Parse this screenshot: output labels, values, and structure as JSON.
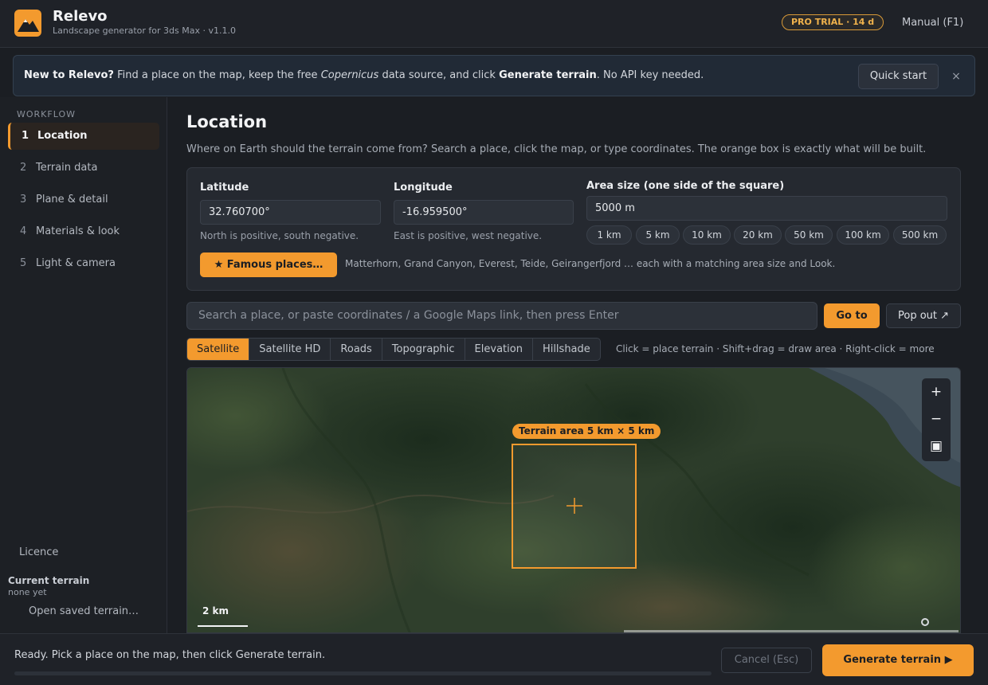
{
  "app": {
    "title": "Relevo",
    "subtitle": "Landscape generator for 3ds Max  ·  v1.1.0",
    "pro_badge": "PRO TRIAL · 14 d",
    "manual_link": "Manual  (F1)"
  },
  "banner": {
    "lead": "New to Relevo?",
    "text_1": " Find a place on the map, keep the free ",
    "source": "Copernicus",
    "text_2": " data source, and click ",
    "action": "Generate terrain",
    "text_3": ". No API key needed.",
    "quick_start": "Quick start",
    "close": "×"
  },
  "sidebar": {
    "section_label": "WORKFLOW",
    "items": [
      {
        "num": "1",
        "label": "Location",
        "active": true
      },
      {
        "num": "2",
        "label": "Terrain data",
        "active": false
      },
      {
        "num": "3",
        "label": "Plane & detail",
        "active": false
      },
      {
        "num": "4",
        "label": "Materials & look",
        "active": false
      },
      {
        "num": "5",
        "label": "Light & camera",
        "active": false
      }
    ],
    "licence": "Licence",
    "current_terrain_label": "Current terrain",
    "current_terrain_value": "none yet",
    "open_saved": "Open saved terrain…"
  },
  "main": {
    "title": "Location",
    "description": "Where on Earth should the terrain come from? Search a place, click the map, or type coordinates. The orange box is exactly what will be built.",
    "latitude": {
      "label": "Latitude",
      "value": "32.760700°",
      "hint": "North is positive, south negative."
    },
    "longitude": {
      "label": "Longitude",
      "value": "-16.959500°",
      "hint": "East is positive, west negative."
    },
    "area": {
      "label": "Area size (one side of the square)",
      "value": "5000 m",
      "presets": [
        "1 km",
        "5 km",
        "10 km",
        "20 km",
        "50 km",
        "100 km",
        "500 km"
      ]
    },
    "famous_button": "★  Famous places…",
    "famous_hint": "Matterhorn, Grand Canyon, Everest, Teide, Geirangerfjord … each with a matching area size and Look.",
    "search_placeholder": "Search a place, or paste coordinates / a Google Maps link, then press Enter",
    "goto_button": "Go to",
    "popout_button": "Pop out ↗",
    "map_tabs": [
      {
        "label": "Satellite",
        "active": true
      },
      {
        "label": "Satellite HD",
        "active": false
      },
      {
        "label": "Roads",
        "active": false
      },
      {
        "label": "Topographic",
        "active": false
      },
      {
        "label": "Elevation",
        "active": false
      },
      {
        "label": "Hillshade",
        "active": false
      }
    ],
    "map_hint": "Click = place terrain · Shift+drag = draw area · Right-click = more"
  },
  "map": {
    "zoom_in": "+",
    "zoom_out": "−",
    "fit": "▣",
    "terrain_label": "Terrain area  5 km × 5 km",
    "scale_label": "2 km"
  },
  "footer": {
    "status": "Ready. Pick a place on the map, then click Generate terrain.",
    "progress": 0,
    "cancel": "Cancel  (Esc)",
    "generate": "Generate terrain  ▶"
  },
  "colors": {
    "accent": "#f39a2e",
    "background": "#1b1e23",
    "panel": "#252930"
  },
  "icons": {
    "logo": "mountain-logo-icon",
    "close": "close-icon",
    "crosshair": "crosshair-icon",
    "locate": "locate-icon"
  }
}
